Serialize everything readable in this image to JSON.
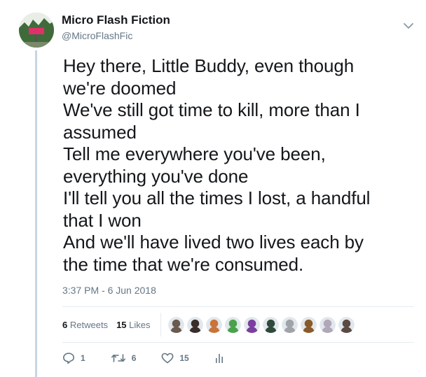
{
  "account": {
    "display_name": "Micro Flash Fiction",
    "handle": "@MicroFlashFic",
    "avatar_icon": "avatar-image"
  },
  "tweet": {
    "lines": [
      "Hey there, Little Buddy, even though",
      "we're doomed",
      "We've still got time to kill, more than I",
      "assumed",
      "Tell me everywhere you've been,",
      "everything you've done",
      "I'll tell you all the times I lost, a handful",
      "that I won",
      "And we'll have lived two lives each by",
      "the time that we're consumed."
    ],
    "timestamp": "3:37 PM - 6 Jun 2018"
  },
  "stats": {
    "retweets_count": "6",
    "retweets_label": "Retweets",
    "likes_count": "15",
    "likes_label": "Likes"
  },
  "likers": [
    {
      "name": "liker-avatar-1",
      "color": "#6b5a4e"
    },
    {
      "name": "liker-avatar-2",
      "color": "#3a2e2a"
    },
    {
      "name": "liker-avatar-3",
      "color": "#c9743b"
    },
    {
      "name": "liker-avatar-4",
      "color": "#4aa24a"
    },
    {
      "name": "liker-avatar-5",
      "color": "#7b3fa0"
    },
    {
      "name": "liker-avatar-6",
      "color": "#2f4a3a"
    },
    {
      "name": "liker-avatar-7",
      "color": "#a0a4a8"
    },
    {
      "name": "liker-avatar-8",
      "color": "#8a5a2a"
    },
    {
      "name": "liker-avatar-9",
      "color": "#b0a8b8"
    },
    {
      "name": "liker-avatar-10",
      "color": "#5a4a44"
    }
  ],
  "actions": {
    "reply_count": "1",
    "retweet_count": "6",
    "like_count": "15"
  },
  "colors": {
    "text": "#14171a",
    "secondary": "#657786",
    "thread_line": "#c5d6e4",
    "divider": "#e6ecf0"
  }
}
